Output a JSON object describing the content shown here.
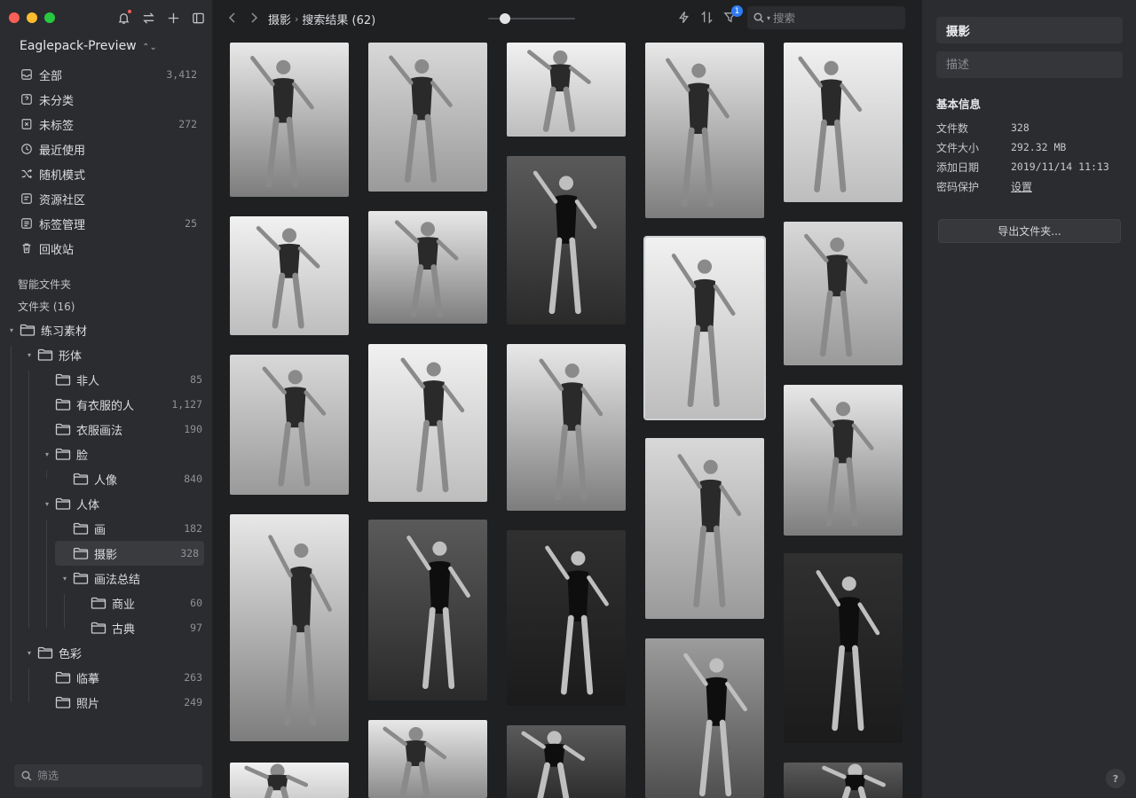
{
  "sidebar": {
    "library_name": "Eaglepack-Preview",
    "nav": [
      {
        "label": "全部",
        "count": "3,412",
        "icon": "inbox-icon"
      },
      {
        "label": "未分类",
        "count": "",
        "icon": "question-box-icon"
      },
      {
        "label": "未标签",
        "count": "272",
        "icon": "untagged-icon"
      },
      {
        "label": "最近使用",
        "count": "",
        "icon": "clock-icon"
      },
      {
        "label": "随机模式",
        "count": "",
        "icon": "shuffle-icon"
      },
      {
        "label": "资源社区",
        "count": "",
        "icon": "community-icon"
      },
      {
        "label": "标签管理",
        "count": "25",
        "icon": "tag-icon"
      },
      {
        "label": "回收站",
        "count": "",
        "icon": "trash-icon"
      }
    ],
    "smart_folders_label": "智能文件夹",
    "folders_label": "文件夹 (16)",
    "tree": [
      {
        "label": "练习素材",
        "count": "",
        "depth": 0,
        "expanded": true
      },
      {
        "label": "形体",
        "count": "",
        "depth": 1,
        "expanded": true
      },
      {
        "label": "非人",
        "count": "85",
        "depth": 2
      },
      {
        "label": "有衣服的人",
        "count": "1,127",
        "depth": 2
      },
      {
        "label": "衣服画法",
        "count": "190",
        "depth": 2
      },
      {
        "label": "脸",
        "count": "",
        "depth": 2,
        "expanded": true
      },
      {
        "label": "人像",
        "count": "840",
        "depth": 3
      },
      {
        "label": "人体",
        "count": "",
        "depth": 2,
        "expanded": true
      },
      {
        "label": "画",
        "count": "182",
        "depth": 3
      },
      {
        "label": "摄影",
        "count": "328",
        "depth": 3,
        "active": true
      },
      {
        "label": "画法总结",
        "count": "",
        "depth": 3,
        "expanded": true
      },
      {
        "label": "商业",
        "count": "60",
        "depth": 4
      },
      {
        "label": "古典",
        "count": "97",
        "depth": 4
      },
      {
        "label": "色彩",
        "count": "",
        "depth": 1,
        "expanded": true
      },
      {
        "label": "临摹",
        "count": "263",
        "depth": 2
      },
      {
        "label": "照片",
        "count": "249",
        "depth": 2
      }
    ],
    "filter_placeholder": "筛选"
  },
  "toolbar": {
    "breadcrumb_folder": "摄影",
    "breadcrumb_result": "搜索结果 (62)",
    "search_placeholder": "搜索",
    "filter_badge": "1",
    "zoom_level": 0.15
  },
  "grid": {
    "thumbnail_count": 22
  },
  "inspector": {
    "name": "摄影",
    "description_placeholder": "描述",
    "section_title": "基本信息",
    "info": [
      {
        "key": "文件数",
        "value": "328"
      },
      {
        "key": "文件大小",
        "value": "292.32 MB"
      },
      {
        "key": "添加日期",
        "value": "2019/11/14 11:13"
      },
      {
        "key": "密码保护",
        "value": "设置",
        "link": true
      }
    ],
    "export_label": "导出文件夹...",
    "help_label": "?"
  }
}
